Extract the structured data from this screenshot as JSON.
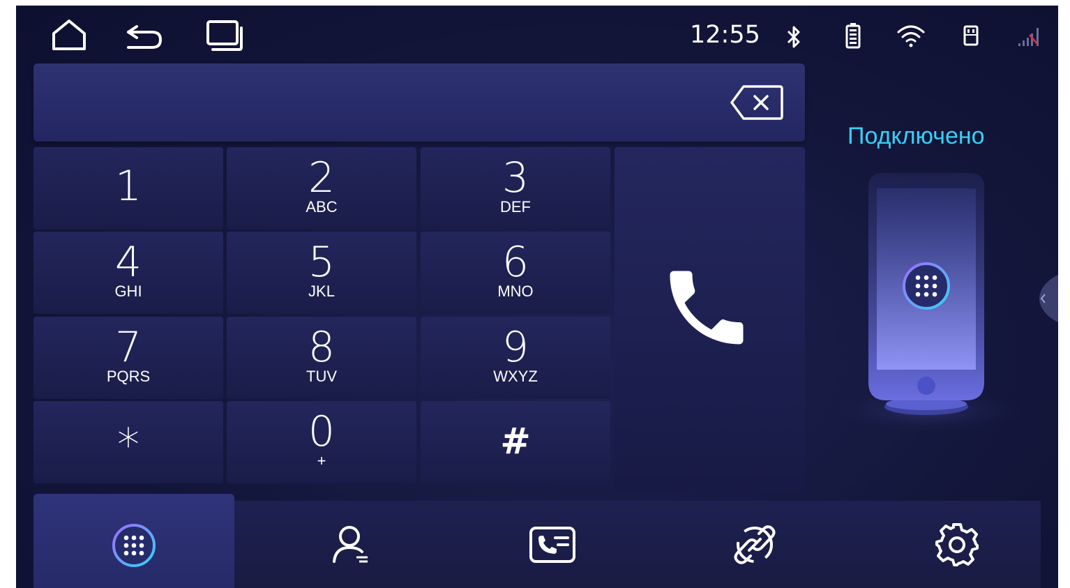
{
  "status_bar": {
    "time": "12:55",
    "icons": [
      "home-icon",
      "back-icon",
      "recents-icon",
      "bluetooth-icon",
      "battery-icon",
      "wifi-icon",
      "usb-icon",
      "signal-icon"
    ]
  },
  "dialer": {
    "input_value": "",
    "backspace_icon": "backspace-icon",
    "keys": [
      {
        "digit": "1",
        "letters": ""
      },
      {
        "digit": "2",
        "letters": "ABC"
      },
      {
        "digit": "3",
        "letters": "DEF"
      },
      {
        "digit": "4",
        "letters": "GHI"
      },
      {
        "digit": "5",
        "letters": "JKL"
      },
      {
        "digit": "6",
        "letters": "MNO"
      },
      {
        "digit": "7",
        "letters": "PQRS"
      },
      {
        "digit": "8",
        "letters": "TUV"
      },
      {
        "digit": "9",
        "letters": "WXYZ"
      },
      {
        "digit": "*",
        "letters": ""
      },
      {
        "digit": "0",
        "letters": "+"
      },
      {
        "digit": "#",
        "letters": ""
      }
    ],
    "call_icon": "phone-icon"
  },
  "connection": {
    "status": "Подключено",
    "phone_icon": "phone-device-icon"
  },
  "tabs": [
    {
      "icon": "dialpad-icon",
      "active": true
    },
    {
      "icon": "contacts-icon",
      "active": false
    },
    {
      "icon": "call-log-icon",
      "active": false
    },
    {
      "icon": "link-icon",
      "active": false
    },
    {
      "icon": "settings-icon",
      "active": false
    }
  ],
  "colors": {
    "background": "#13163a",
    "accent": "#38d0f5",
    "accent_purple": "#7b5cff"
  }
}
